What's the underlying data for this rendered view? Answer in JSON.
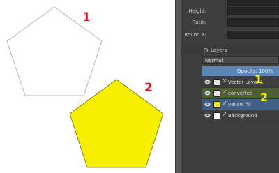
{
  "canvas": {
    "annotations": {
      "one": "1",
      "two": "2"
    },
    "colors": {
      "outline": "#b7b7b7",
      "fill": "#f8ef00",
      "fill_stroke": "#6f6a00",
      "annotation": "#e0141b"
    }
  },
  "panel": {
    "properties": {
      "height_label": "Height:",
      "ratio_label": "Ratio:",
      "round_x_label": "Round X:"
    },
    "layers": {
      "title": "Layers",
      "blend_mode": "Normal",
      "opacity": "Opacity:  100%",
      "items": [
        {
          "name": "Vector Layer 1",
          "thumb": "checker"
        },
        {
          "name": "converted",
          "thumb": "checker"
        },
        {
          "name": "yellow fill",
          "thumb": "yellow"
        },
        {
          "name": "Background",
          "thumb": "white"
        }
      ]
    },
    "annotations": {
      "one": "1",
      "two": "2"
    },
    "colors": {
      "selected_row": "#3f5f84",
      "highlight_row": "#4d5e35",
      "opacity_bar": "#5a86b8",
      "annotation": "#f6f000"
    }
  }
}
